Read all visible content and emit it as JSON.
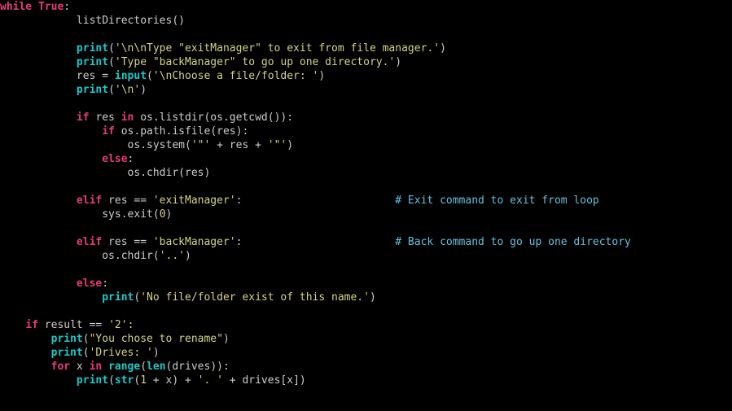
{
  "code": {
    "lines": [
      {
        "indent": 0,
        "tokens": [
          [
            "kw",
            "while"
          ],
          [
            "sp",
            " "
          ],
          [
            "bool",
            "True"
          ],
          [
            "def",
            ":"
          ]
        ]
      },
      {
        "indent": 12,
        "tokens": [
          [
            "call",
            "listDirectories"
          ],
          [
            "paren",
            "()"
          ]
        ]
      },
      {
        "blank": true
      },
      {
        "indent": 12,
        "tokens": [
          [
            "fn",
            "print"
          ],
          [
            "paren",
            "("
          ],
          [
            "str",
            "'\\n\\nType \"exitManager\" to exit from file manager.'"
          ],
          [
            "paren",
            ")"
          ]
        ]
      },
      {
        "indent": 12,
        "tokens": [
          [
            "fn",
            "print"
          ],
          [
            "paren",
            "("
          ],
          [
            "str",
            "'Type \"backManager\" to go up one directory.'"
          ],
          [
            "paren",
            ")"
          ]
        ]
      },
      {
        "indent": 12,
        "tokens": [
          [
            "def",
            "res "
          ],
          [
            "op",
            "="
          ],
          [
            "def",
            " "
          ],
          [
            "fn",
            "input"
          ],
          [
            "paren",
            "("
          ],
          [
            "str",
            "'\\nChoose a file/folder: '"
          ],
          [
            "paren",
            ")"
          ]
        ]
      },
      {
        "indent": 12,
        "tokens": [
          [
            "fn",
            "print"
          ],
          [
            "paren",
            "("
          ],
          [
            "str",
            "'\\n'"
          ],
          [
            "paren",
            ")"
          ]
        ]
      },
      {
        "blank": true
      },
      {
        "indent": 12,
        "tokens": [
          [
            "kw",
            "if"
          ],
          [
            "def",
            " res "
          ],
          [
            "kw",
            "in"
          ],
          [
            "def",
            " os.listdir"
          ],
          [
            "paren",
            "("
          ],
          [
            "def",
            "os.getcwd"
          ],
          [
            "paren",
            "())"
          ],
          [
            "def",
            ":"
          ]
        ]
      },
      {
        "indent": 16,
        "tokens": [
          [
            "kw",
            "if"
          ],
          [
            "def",
            " os.path.isfile"
          ],
          [
            "paren",
            "("
          ],
          [
            "def",
            "res"
          ],
          [
            "paren",
            ")"
          ],
          [
            "def",
            ":"
          ]
        ]
      },
      {
        "indent": 20,
        "tokens": [
          [
            "def",
            "os.system"
          ],
          [
            "paren",
            "("
          ],
          [
            "str",
            "'\"'"
          ],
          [
            "def",
            " "
          ],
          [
            "op",
            "+"
          ],
          [
            "def",
            " res "
          ],
          [
            "op",
            "+"
          ],
          [
            "def",
            " "
          ],
          [
            "str",
            "'\"'"
          ],
          [
            "paren",
            ")"
          ]
        ]
      },
      {
        "indent": 16,
        "tokens": [
          [
            "kw",
            "else"
          ],
          [
            "def",
            ":"
          ]
        ]
      },
      {
        "indent": 20,
        "tokens": [
          [
            "def",
            "os.chdir"
          ],
          [
            "paren",
            "("
          ],
          [
            "def",
            "res"
          ],
          [
            "paren",
            ")"
          ]
        ]
      },
      {
        "blank": true
      },
      {
        "indent": 12,
        "tokens": [
          [
            "kw",
            "elif"
          ],
          [
            "def",
            " res "
          ],
          [
            "op",
            "=="
          ],
          [
            "def",
            " "
          ],
          [
            "str",
            "'exitManager'"
          ],
          [
            "def",
            ":"
          ],
          [
            "pad",
            62
          ],
          [
            "cmt",
            "# Exit command to exit from loop"
          ]
        ]
      },
      {
        "indent": 16,
        "tokens": [
          [
            "def",
            "sys.exit"
          ],
          [
            "paren",
            "("
          ],
          [
            "num",
            "0"
          ],
          [
            "paren",
            ")"
          ]
        ]
      },
      {
        "blank": true
      },
      {
        "indent": 12,
        "tokens": [
          [
            "kw",
            "elif"
          ],
          [
            "def",
            " res "
          ],
          [
            "op",
            "=="
          ],
          [
            "def",
            " "
          ],
          [
            "str",
            "'backManager'"
          ],
          [
            "def",
            ":"
          ],
          [
            "pad",
            62
          ],
          [
            "cmt",
            "# Back command to go up one directory"
          ]
        ]
      },
      {
        "indent": 16,
        "tokens": [
          [
            "def",
            "os.chdir"
          ],
          [
            "paren",
            "("
          ],
          [
            "str",
            "'..'"
          ],
          [
            "paren",
            ")"
          ]
        ]
      },
      {
        "blank": true
      },
      {
        "indent": 12,
        "tokens": [
          [
            "kw",
            "else"
          ],
          [
            "def",
            ":"
          ]
        ]
      },
      {
        "indent": 16,
        "tokens": [
          [
            "fn",
            "print"
          ],
          [
            "paren",
            "("
          ],
          [
            "str",
            "'No file/folder exist of this name.'"
          ],
          [
            "paren",
            ")"
          ]
        ]
      },
      {
        "blank": true
      },
      {
        "indent": 4,
        "tokens": [
          [
            "kw",
            "if"
          ],
          [
            "def",
            " result "
          ],
          [
            "op",
            "=="
          ],
          [
            "def",
            " "
          ],
          [
            "str",
            "'2'"
          ],
          [
            "def",
            ":"
          ]
        ]
      },
      {
        "indent": 8,
        "tokens": [
          [
            "fn",
            "print"
          ],
          [
            "paren",
            "("
          ],
          [
            "str",
            "\"You chose to rename\""
          ],
          [
            "paren",
            ")"
          ]
        ]
      },
      {
        "indent": 8,
        "tokens": [
          [
            "fn",
            "print"
          ],
          [
            "paren",
            "("
          ],
          [
            "str",
            "'Drives: '"
          ],
          [
            "paren",
            ")"
          ]
        ]
      },
      {
        "indent": 8,
        "tokens": [
          [
            "kw",
            "for"
          ],
          [
            "def",
            " x "
          ],
          [
            "kw",
            "in"
          ],
          [
            "def",
            " "
          ],
          [
            "fn",
            "range"
          ],
          [
            "paren",
            "("
          ],
          [
            "fn",
            "len"
          ],
          [
            "paren",
            "("
          ],
          [
            "def",
            "drives"
          ],
          [
            "paren",
            ")):"
          ]
        ]
      },
      {
        "indent": 12,
        "tokens": [
          [
            "fn",
            "print"
          ],
          [
            "paren",
            "("
          ],
          [
            "fn",
            "str"
          ],
          [
            "paren",
            "("
          ],
          [
            "num",
            "1"
          ],
          [
            "def",
            " "
          ],
          [
            "op",
            "+"
          ],
          [
            "def",
            " x"
          ],
          [
            "paren",
            ")"
          ],
          [
            "def",
            " "
          ],
          [
            "op",
            "+"
          ],
          [
            "def",
            " "
          ],
          [
            "str",
            "'. '"
          ],
          [
            "def",
            " "
          ],
          [
            "op",
            "+"
          ],
          [
            "def",
            " drives"
          ],
          [
            "paren",
            "["
          ],
          [
            "def",
            "x"
          ],
          [
            "paren",
            "])"
          ]
        ]
      }
    ]
  }
}
